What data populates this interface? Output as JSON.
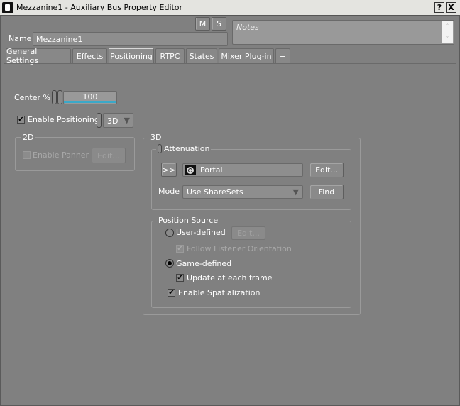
{
  "window": {
    "title": "Mezzanine1 - Auxiliary Bus Property Editor",
    "help_label": "?",
    "close_label": "X"
  },
  "header": {
    "mute_label": "M",
    "solo_label": "S",
    "name_label": "Name",
    "name_value": "Mezzanine1",
    "notes_placeholder": "Notes"
  },
  "tabs": [
    {
      "label": "General Settings"
    },
    {
      "label": "Effects"
    },
    {
      "label": "Positioning",
      "active": true
    },
    {
      "label": "RTPC"
    },
    {
      "label": "States"
    },
    {
      "label": "Mixer Plug-in"
    },
    {
      "label": "+"
    }
  ],
  "positioning": {
    "center_label": "Center %",
    "center_value": "100",
    "center_percent": 100,
    "enable_positioning_label": "Enable Positioning:",
    "enable_positioning_checked": true,
    "mode_value": "3D",
    "group_2d": {
      "title": "2D",
      "enable_panner_label": "Enable Panner",
      "enable_panner_checked": false,
      "edit_label": "Edit..."
    },
    "group_3d": {
      "title": "3D",
      "attenuation": {
        "title": "Attenuation",
        "expand_label": ">>",
        "shareset_value": "Portal",
        "edit_label": "Edit...",
        "mode_label": "Mode",
        "mode_value": "Use ShareSets",
        "find_label": "Find"
      },
      "position_source": {
        "title": "Position Source",
        "user_defined_label": "User-defined",
        "user_defined_selected": false,
        "edit_label": "Edit...",
        "follow_listener_label": "Follow Listener Orientation",
        "follow_listener_checked": true,
        "game_defined_label": "Game-defined",
        "game_defined_selected": true,
        "update_each_frame_label": "Update at each frame",
        "update_each_frame_checked": true,
        "enable_spatialization_label": "Enable Spatialization",
        "enable_spatialization_checked": true
      }
    }
  },
  "colors": {
    "accent": "#3aa8c8",
    "background": "#808080"
  }
}
